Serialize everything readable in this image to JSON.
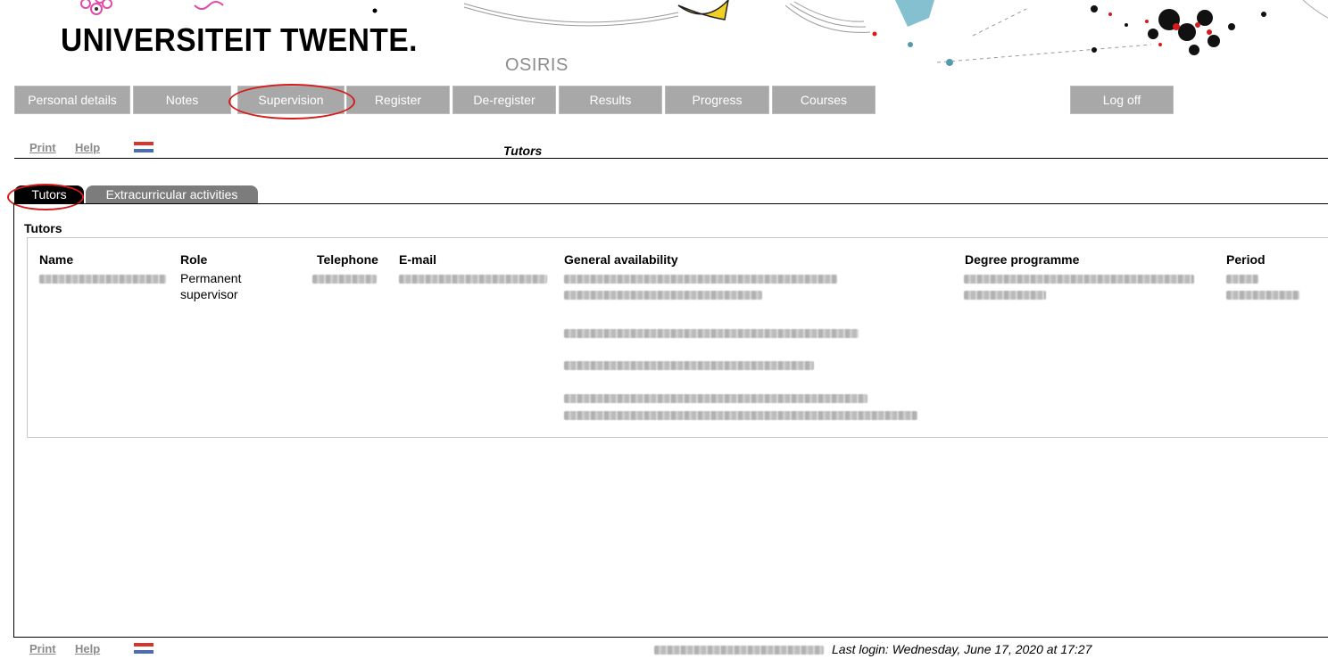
{
  "header": {
    "logo_text": "UNIVERSITEIT TWENTE.",
    "app_name": "OSIRIS"
  },
  "nav": {
    "items": [
      {
        "label": "Personal details"
      },
      {
        "label": "Notes"
      },
      {
        "label": "Supervision"
      },
      {
        "label": "Register"
      },
      {
        "label": "De-register"
      },
      {
        "label": "Results"
      },
      {
        "label": "Progress"
      },
      {
        "label": "Courses"
      }
    ],
    "logoff_label": "Log off"
  },
  "toolbar": {
    "print_label": "Print",
    "help_label": "Help",
    "page_title": "Tutors"
  },
  "tabs": [
    {
      "label": "Tutors",
      "active": true
    },
    {
      "label": "Extracurricular activities",
      "active": false
    }
  ],
  "section_title": "Tutors",
  "table": {
    "headers": {
      "name": "Name",
      "role": "Role",
      "telephone": "Telephone",
      "email": "E-mail",
      "availability": "General availability",
      "programme": "Degree programme",
      "period": "Period"
    },
    "row": {
      "role_line1": "Permanent",
      "role_line2": "supervisor"
    }
  },
  "footer": {
    "print_label": "Print",
    "help_label": "Help",
    "last_login": "Last login: Wednesday, June 17, 2020 at 17:27"
  },
  "colors": {
    "nav_bg": "#a8a8a8",
    "highlight_ring": "#d41c1c",
    "tab_active": "#000000",
    "tab_inactive": "#7c7c7c"
  }
}
